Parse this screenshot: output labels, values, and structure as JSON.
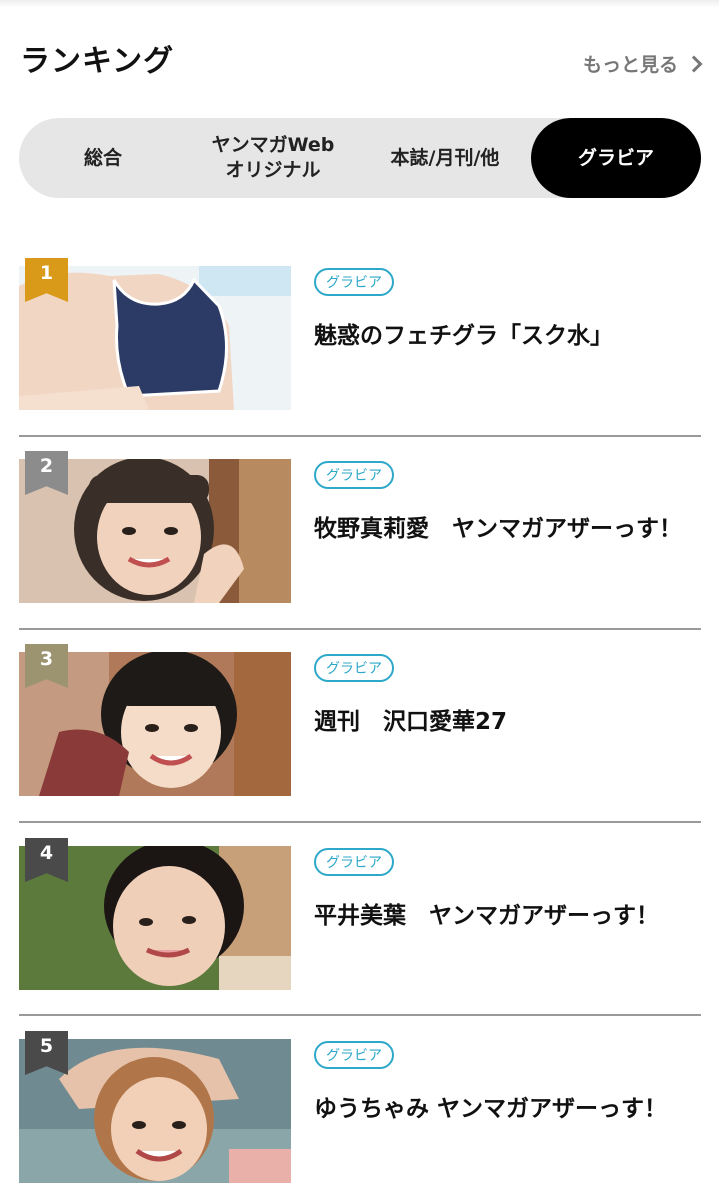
{
  "header": {
    "title": "ランキング",
    "more_label": "もっと見る"
  },
  "tabs": [
    {
      "label": "総合",
      "active": false
    },
    {
      "label": "ヤンマガWeb\nオリジナル",
      "active": false
    },
    {
      "label": "本誌/月刊/他",
      "active": false
    },
    {
      "label": "グラビア",
      "active": true
    }
  ],
  "rankings": [
    {
      "rank": "1",
      "tag": "グラビア",
      "title": "魅惑のフェチグラ「スク水」",
      "badge_color": "#d99a1a"
    },
    {
      "rank": "2",
      "tag": "グラビア",
      "title": "牧野真莉愛　ヤンマガアザーっす！",
      "badge_color": "#8c8c8c"
    },
    {
      "rank": "3",
      "tag": "グラビア",
      "title": "週刊　沢口愛華27",
      "badge_color": "#9c9470"
    },
    {
      "rank": "4",
      "tag": "グラビア",
      "title": "平井美葉　ヤンマガアザーっす！",
      "badge_color": "#4a4a4a"
    },
    {
      "rank": "5",
      "tag": "グラビア",
      "title": "ゆうちゃみ ヤンマガアザーっす！",
      "badge_color": "#4a4a4a"
    }
  ],
  "colors": {
    "accent": "#2ea8c9",
    "active_tab_bg": "#000000",
    "tab_bar_bg": "#e6e6e6"
  }
}
